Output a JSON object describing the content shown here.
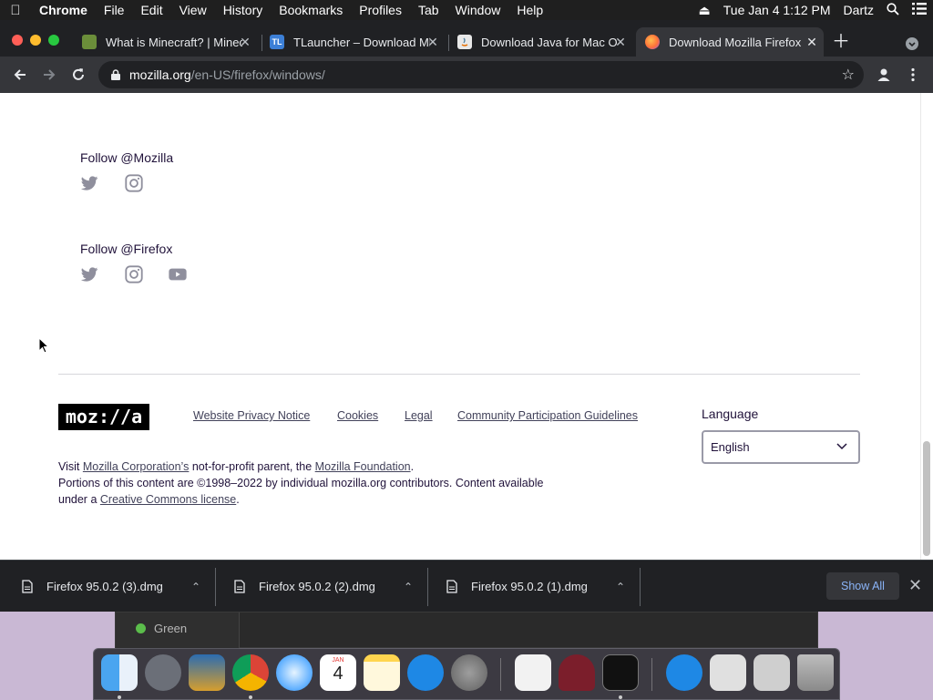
{
  "menubar": {
    "app_name": "Chrome",
    "items": [
      "File",
      "Edit",
      "View",
      "History",
      "Bookmarks",
      "Profiles",
      "Tab",
      "Window",
      "Help"
    ],
    "datetime": "Tue Jan 4  1:12 PM",
    "user": "Dartz"
  },
  "tabs": [
    {
      "title": "What is Minecraft? | Minec",
      "favicon": "minecraft-icon",
      "active": false
    },
    {
      "title": "TLauncher – Download Min",
      "favicon": "tlauncher-icon",
      "favicon_text": "TL",
      "active": false
    },
    {
      "title": "Download Java for Mac OS",
      "favicon": "java-icon",
      "active": false
    },
    {
      "title": "Download Mozilla Firefox",
      "favicon": "firefox-icon",
      "active": true
    }
  ],
  "address_bar": {
    "host": "mozilla.org",
    "path": "/en-US/firefox/windows/"
  },
  "page": {
    "follow_mozilla": "Follow @Mozilla",
    "follow_firefox": "Follow @Firefox",
    "logo_text": "moz://a",
    "footer_links": [
      "Website Privacy Notice",
      "Cookies",
      "Legal",
      "Community Participation Guidelines"
    ],
    "language_label": "Language",
    "language_value": "English",
    "legal": {
      "visit": "Visit",
      "corp_link": "Mozilla Corporation’s",
      "middle": "not-for-profit parent, the",
      "foundation_link": "Mozilla Foundation",
      "end": ".",
      "line2": "Portions of this content are ©1998–2022 by individual mozilla.org contributors. Content available",
      "line3_start": "under a",
      "license_link": "Creative Commons license",
      "line3_end": "."
    }
  },
  "downloads": {
    "items": [
      "Firefox 95.0.2 (3).dmg",
      "Firefox 95.0.2 (2).dmg",
      "Firefox 95.0.2 (1).dmg"
    ],
    "show_all": "Show All"
  },
  "background_window": {
    "tag_label": "Green"
  },
  "dock": {
    "calendar_month": "JAN",
    "calendar_day": "4"
  },
  "colors": {
    "chrome_dark": "#202124",
    "toolbar": "#35363a",
    "mozilla_text": "#20123a",
    "link_blue": "#8ab4f8"
  }
}
